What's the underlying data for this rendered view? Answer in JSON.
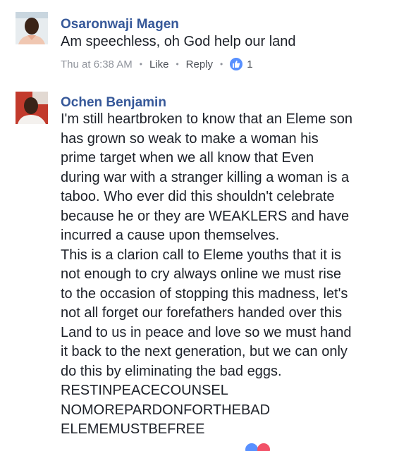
{
  "comments": [
    {
      "author": "Osaronwaji Magen",
      "lines": [
        "Am speechless, oh  God help our land"
      ],
      "time": "Thu at 6:38 AM",
      "like_label": "Like",
      "reply_label": "Reply",
      "reaction_count": "1"
    },
    {
      "author": "Ochen Benjamin",
      "lines": [
        "I'm still heartbroken to know that an Eleme son",
        "has grown so weak to make a woman his",
        "prime target when we all know that Even",
        "during war with a stranger killing a woman is a",
        "taboo. Who ever did this shouldn't celebrate",
        "because he or they are WEAKLERS and have",
        "incurred a cause upon themselves.",
        "This is a clarion call to Eleme youths that it is",
        "not enough to cry always online we must rise",
        "to the occasion of stopping this madness, let's",
        "not all forget our forefathers handed over this",
        "Land to us in peace and love so we must hand",
        "it back to the next generation, but we can only",
        "do this by eliminating the bad eggs.",
        "RESTINPEACECOUNSEL",
        "NOMOREPARDONFORTHEBAD",
        "ELEMEMUSTBEFREE"
      ]
    }
  ],
  "colors": {
    "name": "#365899",
    "meta": "#90949c",
    "like_badge": "#5890ff",
    "love_badge": "#f25268"
  }
}
